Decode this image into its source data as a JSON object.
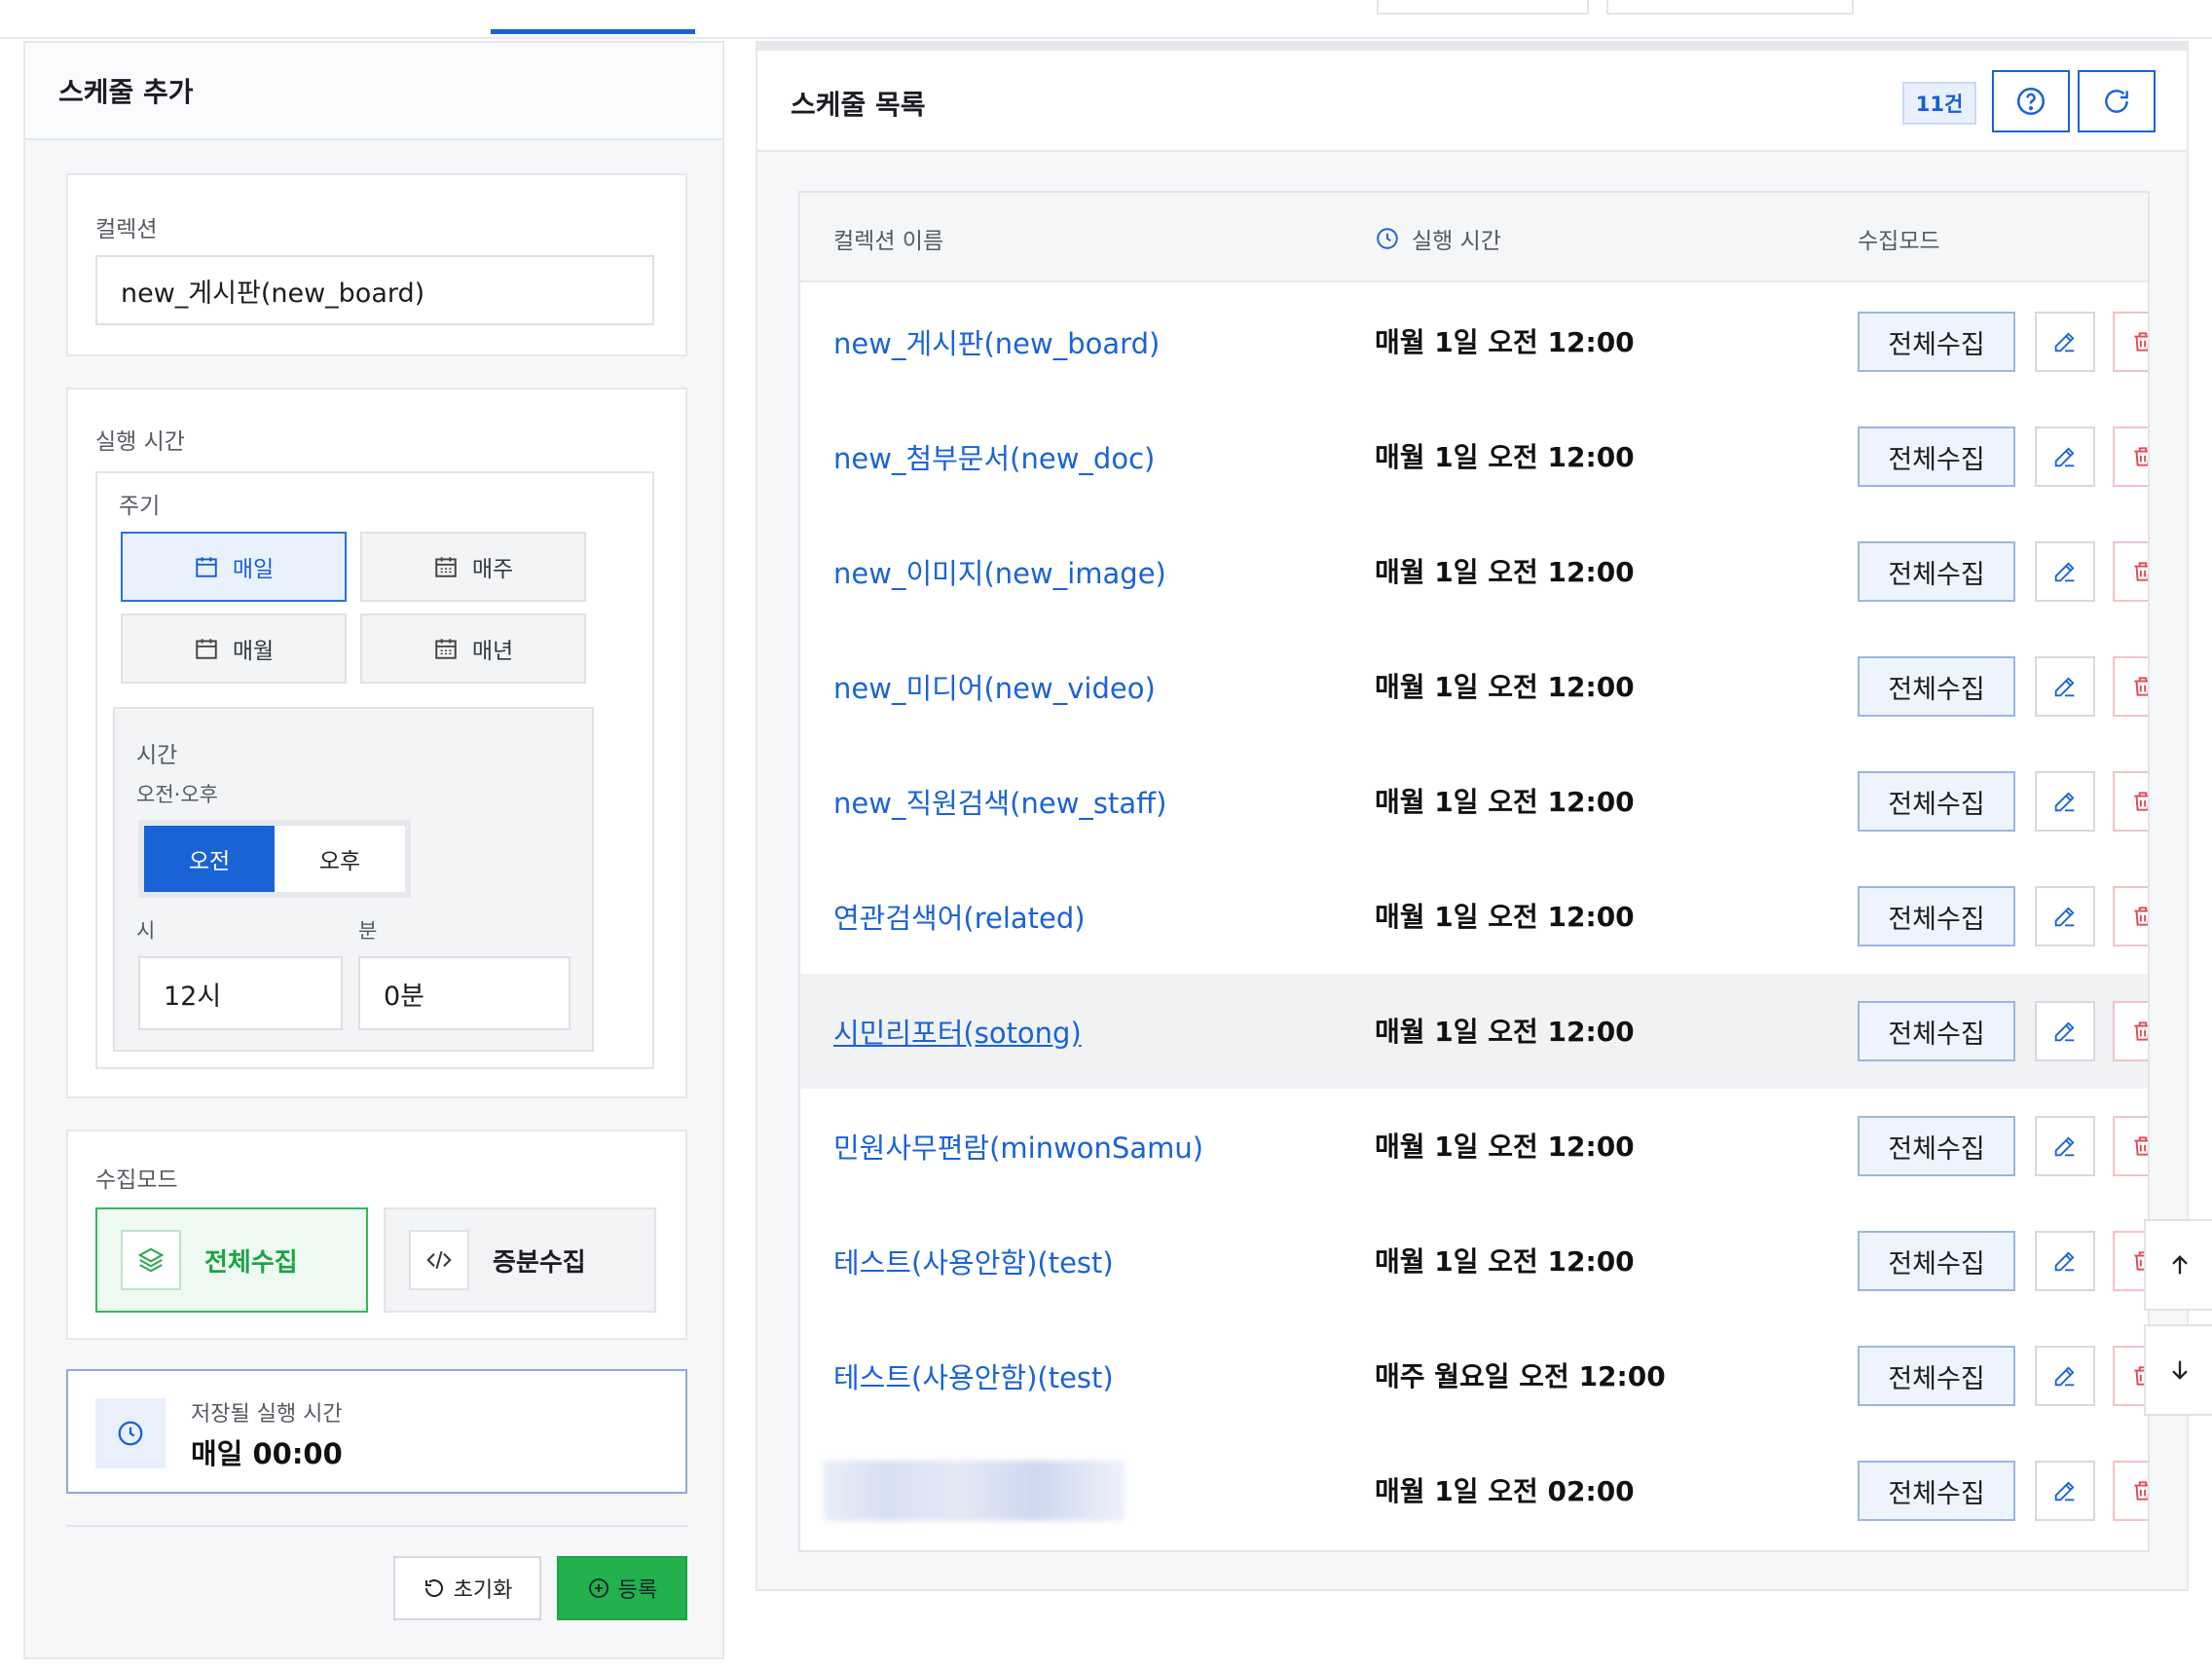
{
  "left_panel": {
    "title": "스케줄 추가",
    "collection": {
      "label": "컬렉션",
      "value": "new_게시판(new_board)"
    },
    "run_time": {
      "label": "실행 시간",
      "period": {
        "label": "주기",
        "options": [
          "매일",
          "매주",
          "매월",
          "매년"
        ],
        "selected": "매일"
      },
      "time": {
        "label": "시간",
        "ampm_label": "오전·오후",
        "am": "오전",
        "pm": "오후",
        "selected": "오전",
        "hour_label": "시",
        "hour_value": "12시",
        "minute_label": "분",
        "minute_value": "0분"
      }
    },
    "collect_mode": {
      "label": "수집모드",
      "full": "전체수집",
      "incremental": "증분수집",
      "selected": "전체수집"
    },
    "summary": {
      "label": "저장될 실행 시간",
      "value": "매일 00:00"
    },
    "buttons": {
      "reset": "초기화",
      "register": "등록"
    }
  },
  "right_panel": {
    "title": "스케줄 목록",
    "count": "11건",
    "columns": {
      "name": "컬렉션 이름",
      "time": "실행 시간",
      "mode": "수집모드"
    },
    "rows": [
      {
        "name": "new_게시판(new_board)",
        "time": "매월 1일 오전 12:00",
        "mode": "전체수집"
      },
      {
        "name": "new_첨부문서(new_doc)",
        "time": "매월 1일 오전 12:00",
        "mode": "전체수집"
      },
      {
        "name": "new_이미지(new_image)",
        "time": "매월 1일 오전 12:00",
        "mode": "전체수집"
      },
      {
        "name": "new_미디어(new_video)",
        "time": "매월 1일 오전 12:00",
        "mode": "전체수집"
      },
      {
        "name": "new_직원검색(new_staff)",
        "time": "매월 1일 오전 12:00",
        "mode": "전체수집"
      },
      {
        "name": "연관검색어(related)",
        "time": "매월 1일 오전 12:00",
        "mode": "전체수집"
      },
      {
        "name": "시민리포터(sotong)",
        "time": "매월 1일 오전 12:00",
        "mode": "전체수집"
      },
      {
        "name": "민원사무편람(minwonSamu)",
        "time": "매월 1일 오전 12:00",
        "mode": "전체수집"
      },
      {
        "name": "테스트(사용안함)(test)",
        "time": "매월 1일 오전 12:00",
        "mode": "전체수집"
      },
      {
        "name": "테스트(사용안함)(test)",
        "time": "매주 월요일 오전 12:00",
        "mode": "전체수집"
      },
      {
        "name": "",
        "time": "매월 1일 오전 02:00",
        "mode": "전체수집"
      }
    ]
  },
  "colors": {
    "primary": "#1a63d6",
    "green": "#22b14c",
    "danger": "#e24a55"
  }
}
